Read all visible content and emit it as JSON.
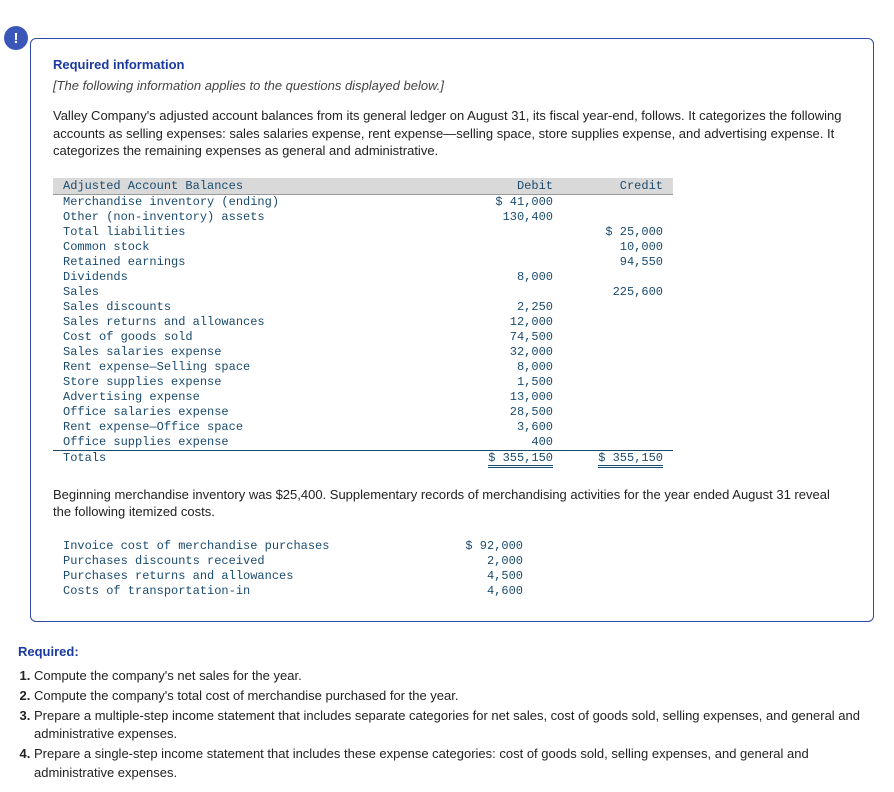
{
  "badge": "!",
  "heading": "Required information",
  "intro": "[The following information applies to the questions displayed below.]",
  "context": "Valley Company's adjusted account balances from its general ledger on August 31, its fiscal year-end, follows. It categorizes the following accounts as selling expenses: sales salaries expense, rent expense—selling space, store supplies expense, and advertising expense. It categorizes the remaining expenses as general and administrative.",
  "ledger": {
    "head_acct": "Adjusted Account Balances",
    "head_debit": "Debit",
    "head_credit": "Credit",
    "rows": [
      {
        "label": "Merchandise inventory (ending)",
        "debit": "$ 41,000",
        "credit": ""
      },
      {
        "label": "Other (non-inventory) assets",
        "debit": "130,400",
        "credit": ""
      },
      {
        "label": "Total liabilities",
        "debit": "",
        "credit": "$ 25,000"
      },
      {
        "label": "Common stock",
        "debit": "",
        "credit": "10,000"
      },
      {
        "label": "Retained earnings",
        "debit": "",
        "credit": "94,550"
      },
      {
        "label": "Dividends",
        "debit": "8,000",
        "credit": ""
      },
      {
        "label": "Sales",
        "debit": "",
        "credit": "225,600"
      },
      {
        "label": "Sales discounts",
        "debit": "2,250",
        "credit": ""
      },
      {
        "label": "Sales returns and allowances",
        "debit": "12,000",
        "credit": ""
      },
      {
        "label": "Cost of goods sold",
        "debit": "74,500",
        "credit": ""
      },
      {
        "label": "Sales salaries expense",
        "debit": "32,000",
        "credit": ""
      },
      {
        "label": "Rent expense—Selling space",
        "debit": "8,000",
        "credit": ""
      },
      {
        "label": "Store supplies expense",
        "debit": "1,500",
        "credit": ""
      },
      {
        "label": "Advertising expense",
        "debit": "13,000",
        "credit": ""
      },
      {
        "label": "Office salaries expense",
        "debit": "28,500",
        "credit": ""
      },
      {
        "label": "Rent expense—Office space",
        "debit": "3,600",
        "credit": ""
      },
      {
        "label": "Office supplies expense",
        "debit": "400",
        "credit": ""
      }
    ],
    "totals_label": "Totals",
    "totals_debit": "$ 355,150",
    "totals_credit": "$ 355,150"
  },
  "supp_text": "Beginning merchandise inventory was $25,400. Supplementary records of merchandising activities for the year ended August 31 reveal the following itemized costs.",
  "supp": {
    "rows": [
      {
        "label": "Invoice cost of merchandise purchases",
        "value": "$ 92,000"
      },
      {
        "label": "Purchases discounts received",
        "value": "2,000"
      },
      {
        "label": "Purchases returns and allowances",
        "value": "4,500"
      },
      {
        "label": "Costs of transportation-in",
        "value": "4,600"
      }
    ]
  },
  "required_heading": "Required:",
  "required_items": [
    "Compute the company's net sales for the year.",
    "Compute the company's total cost of merchandise purchased for the year.",
    "Prepare a multiple-step income statement that includes separate categories for net sales, cost of goods sold, selling expenses, and general and administrative expenses.",
    "Prepare a single-step income statement that includes these expense categories: cost of goods sold, selling expenses, and general and administrative expenses."
  ],
  "chart_data": {
    "type": "table",
    "title": "Adjusted Account Balances",
    "columns": [
      "Account",
      "Debit",
      "Credit"
    ],
    "rows": [
      [
        "Merchandise inventory (ending)",
        41000,
        null
      ],
      [
        "Other (non-inventory) assets",
        130400,
        null
      ],
      [
        "Total liabilities",
        null,
        25000
      ],
      [
        "Common stock",
        null,
        10000
      ],
      [
        "Retained earnings",
        null,
        94550
      ],
      [
        "Dividends",
        8000,
        null
      ],
      [
        "Sales",
        null,
        225600
      ],
      [
        "Sales discounts",
        2250,
        null
      ],
      [
        "Sales returns and allowances",
        12000,
        null
      ],
      [
        "Cost of goods sold",
        74500,
        null
      ],
      [
        "Sales salaries expense",
        32000,
        null
      ],
      [
        "Rent expense—Selling space",
        8000,
        null
      ],
      [
        "Store supplies expense",
        1500,
        null
      ],
      [
        "Advertising expense",
        13000,
        null
      ],
      [
        "Office salaries expense",
        28500,
        null
      ],
      [
        "Rent expense—Office space",
        3600,
        null
      ],
      [
        "Office supplies expense",
        400,
        null
      ]
    ],
    "totals": {
      "Debit": 355150,
      "Credit": 355150
    },
    "supplementary": {
      "beginning_inventory": 25400,
      "invoice_cost_of_merchandise_purchases": 92000,
      "purchases_discounts_received": 2000,
      "purchases_returns_and_allowances": 4500,
      "costs_of_transportation_in": 4600
    }
  }
}
